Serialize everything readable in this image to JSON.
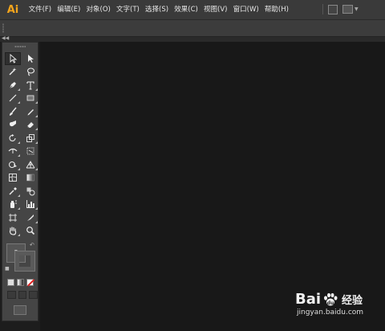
{
  "app": {
    "logo": "Ai"
  },
  "menu": [
    "文件(F)",
    "编辑(E)",
    "对象(O)",
    "文字(T)",
    "选择(S)",
    "效果(C)",
    "视图(V)",
    "窗口(W)",
    "帮助(H)"
  ],
  "toolbar_buttons": [
    "bridge-icon",
    "workspace-switcher-icon"
  ],
  "tools": [
    "selection-tool",
    "direct-selection-tool",
    "magic-wand-tool",
    "lasso-tool",
    "pen-tool",
    "type-tool",
    "line-segment-tool",
    "rectangle-tool",
    "paintbrush-tool",
    "pencil-tool",
    "blob-brush-tool",
    "eraser-tool",
    "rotate-tool",
    "scale-tool",
    "width-tool",
    "free-transform-tool",
    "shape-builder-tool",
    "perspective-grid-tool",
    "mesh-tool",
    "gradient-tool",
    "eyedropper-tool",
    "blend-tool",
    "symbol-sprayer-tool",
    "column-graph-tool",
    "artboard-tool",
    "slice-tool",
    "hand-tool",
    "zoom-tool"
  ],
  "fill_stroke": {
    "fill_label": "?"
  },
  "watermark": {
    "brand": "Bai",
    "brand2": "du",
    "cn": "经验",
    "url": "jingyan.baidu.com"
  },
  "colors": {
    "accent": "#f4a51c",
    "canvas": "#181818",
    "panel": "#454545"
  }
}
